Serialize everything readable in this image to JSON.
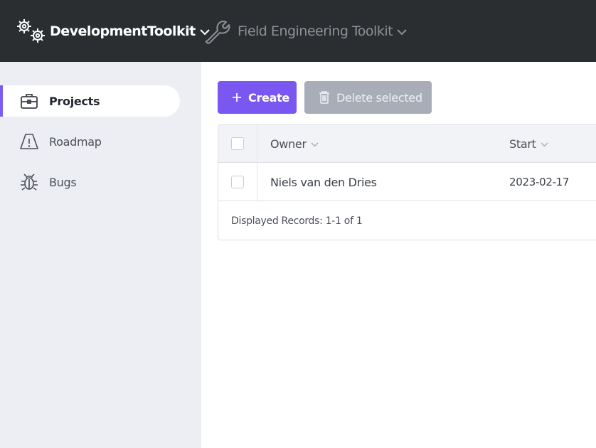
{
  "topbar": {
    "apps": [
      {
        "name": "DevelopmentToolkit",
        "icon": "gears-icon",
        "active": true
      },
      {
        "name": "Field Engineering Toolkit",
        "icon": "wrench-icon",
        "active": false
      }
    ]
  },
  "sidebar": {
    "items": [
      {
        "label": "Projects",
        "icon": "briefcase-icon",
        "active": true
      },
      {
        "label": "Roadmap",
        "icon": "warning-icon",
        "active": false
      },
      {
        "label": "Bugs",
        "icon": "bug-icon",
        "active": false
      }
    ]
  },
  "toolbar": {
    "create_label": "Create",
    "delete_label": "Delete selected"
  },
  "table": {
    "columns": [
      "Owner",
      "Start"
    ],
    "rows": [
      {
        "owner": "Niels van den Dries",
        "start": "2023-02-17"
      }
    ],
    "footer": "Displayed Records: 1-1 of 1"
  },
  "colors": {
    "topbar": "#2b2e31",
    "accent": "#7a57f0",
    "sidebar": "#eceef3",
    "disabled_button": "#a9adb8"
  }
}
